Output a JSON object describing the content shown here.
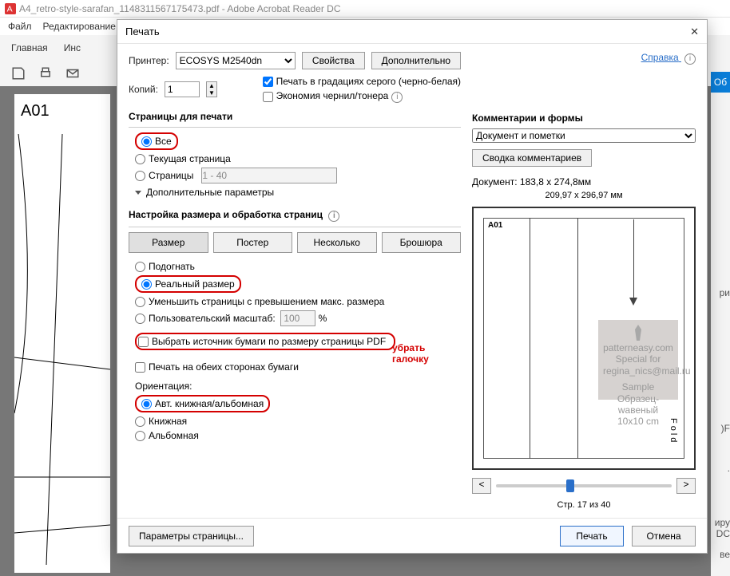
{
  "app": {
    "title": "A4_retro-style-sarafan_1148311567175473.pdf - Adobe Acrobat Reader DC",
    "menu": {
      "file": "Файл",
      "edit": "Редактирование"
    },
    "tabs": {
      "home": "Главная",
      "tools_frag": "Инс"
    },
    "blue_btn": "Об"
  },
  "doc_preview": {
    "page_label": "A01"
  },
  "dialog": {
    "title": "Печать",
    "printer_label": "Принтер:",
    "printer_value": "ECOSYS M2540dn",
    "properties": "Свойства",
    "advanced": "Дополнительно",
    "help": "Справка",
    "copies_label": "Копий:",
    "copies_value": "1",
    "grayscale": "Печать в градациях серого (черно-белая)",
    "ink_economy": "Экономия чернил/тонера",
    "pages_section": "Страницы для печати",
    "all": "Все",
    "current": "Текущая страница",
    "pages_radio": "Страницы",
    "pages_range": "1 - 40",
    "more_params": "Дополнительные параметры",
    "sizing_section": "Настройка размера и обработка страниц",
    "tab_size": "Размер",
    "tab_poster": "Постер",
    "tab_multi": "Несколько",
    "tab_booklet": "Брошюра",
    "fit": "Подогнать",
    "actual": "Реальный размер",
    "shrink": "Уменьшить страницы с превышением макс. размера",
    "custom_scale": "Пользовательский масштаб:",
    "scale_val": "100",
    "pct": "%",
    "paper_source": "Выбрать источник бумаги по размеру страницы PDF",
    "duplex": "Печать на обеих сторонах бумаги",
    "orientation_label": "Ориентация:",
    "orient_auto": "Авт. книжная/альбомная",
    "orient_portrait": "Книжная",
    "orient_landscape": "Альбомная",
    "comments_section": "Комментарии и формы",
    "comments_select": "Документ и пометки",
    "summary_btn": "Сводка комментариев",
    "doc_size": "Документ: 183,8 x 274,8мм",
    "paper_size": "209,97 x 296,97 мм",
    "preview_label": "A01",
    "wm_line1": "patterneasy.com",
    "wm_line2": "Special for",
    "wm_line3": "regina_nics@mail.ru",
    "wm_line4": "Sample",
    "wm_line5": "Образец-wавеный",
    "wm_line6": "10x10 cm",
    "fold_text": "Fold",
    "nav_prev": "<",
    "nav_next": ">",
    "page_indicator": "Стр. 17 из 40",
    "page_setup": "Параметры страницы...",
    "print_btn": "Печать",
    "cancel_btn": "Отмена"
  },
  "annotation": {
    "line1": "убрать",
    "line2": "галочку"
  },
  "bg_fragments": {
    "f1": "ри",
    "f2": ")F",
    "f3": ".",
    "f4": "иру",
    "f5": "DC",
    "f6": "ве"
  }
}
